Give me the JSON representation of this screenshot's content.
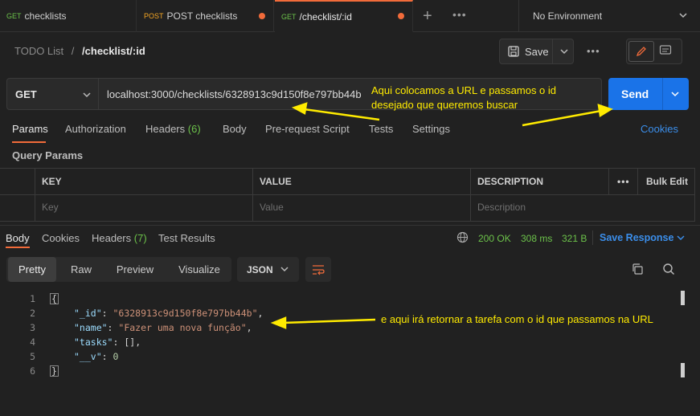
{
  "tabs": [
    {
      "method": "GET",
      "label": "checklists"
    },
    {
      "method": "POST",
      "label": "POST checklists"
    },
    {
      "method": "GET",
      "label": "/checklist/:id"
    }
  ],
  "environment": "No Environment",
  "breadcrumb": {
    "collection": "TODO List",
    "separator": "/",
    "request": "/checklist/:id"
  },
  "save_label": "Save",
  "request": {
    "method": "GET",
    "url": "localhost:3000/checklists/6328913c9d150f8e797bb44b",
    "send_label": "Send"
  },
  "request_tabs": [
    "Params",
    "Authorization",
    "Headers",
    "(6)",
    "Body",
    "Pre-request Script",
    "Tests",
    "Settings"
  ],
  "cookies_label": "Cookies",
  "query_params_title": "Query Params",
  "params_table": {
    "headers": [
      "KEY",
      "VALUE",
      "DESCRIPTION",
      "Bulk Edit"
    ],
    "placeholders": [
      "Key",
      "Value",
      "Description"
    ]
  },
  "response_tabs": [
    "Body",
    "Cookies",
    "Headers",
    "(7)",
    "Test Results"
  ],
  "response_status": {
    "status": "200 OK",
    "time": "308 ms",
    "size": "321 B",
    "save": "Save Response"
  },
  "format_tabs": [
    "Pretty",
    "Raw",
    "Preview",
    "Visualize"
  ],
  "format_select": "JSON",
  "code_lines": [
    {
      "n": "1",
      "text": "{"
    },
    {
      "n": "2",
      "key": "\"_id\"",
      "value": "\"6328913c9d150f8e797bb44b\"",
      "tail": ","
    },
    {
      "n": "3",
      "key": "\"name\"",
      "value": "\"Fazer uma nova função\"",
      "tail": ","
    },
    {
      "n": "4",
      "key": "\"tasks\"",
      "value": "[]",
      "tail": ","
    },
    {
      "n": "5",
      "key": "\"__v\"",
      "value": "0",
      "tail": ""
    },
    {
      "n": "6",
      "text": "}"
    }
  ],
  "annotations": {
    "url_note_1": "Aqui colocamos a URL e passamos o id",
    "url_note_2": "desejado que queremos buscar",
    "response_note": "e aqui irá retornar a tarefa com o id que passamos na URL"
  },
  "colors": {
    "accent": "#f26b3a",
    "send": "#1a73e8",
    "status_ok": "#6cc24a",
    "annotation": "#ffeb00"
  }
}
